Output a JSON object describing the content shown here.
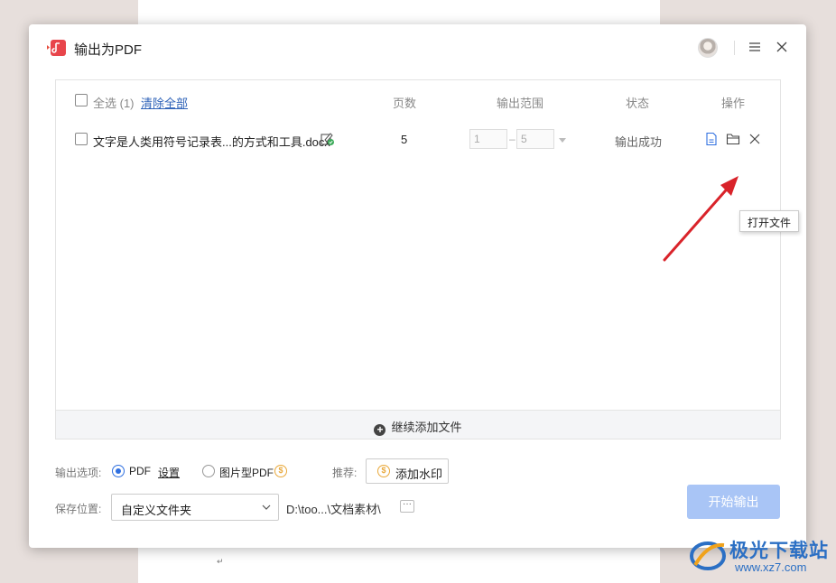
{
  "dialog": {
    "title": "输出为PDF"
  },
  "list": {
    "headers": {
      "select_all": "全选 (1)",
      "clear_all": "清除全部",
      "pages": "页数",
      "range": "输出范围",
      "status": "状态",
      "actions": "操作"
    },
    "rows": [
      {
        "filename": "文字是人类用符号记录表...的方式和工具.docx",
        "pages": "5",
        "range_from": "1",
        "range_to": "5",
        "range_dash": "–",
        "status": "输出成功"
      }
    ],
    "tooltip": "打开文件",
    "add_more": "继续添加文件"
  },
  "options": {
    "label": "输出选项:",
    "pdf": "PDF",
    "settings": "设置",
    "image_pdf": "图片型PDF",
    "recommend_label": "推荐:",
    "add_watermark": "添加水印",
    "save_label": "保存位置:",
    "save_select": "自定义文件夹",
    "save_path": "D:\\too...\\文档素材\\",
    "more": "···",
    "start": "开始输出"
  },
  "background": {
    "doc_mark": "↵"
  },
  "watermark": {
    "brand": "极光下载站",
    "url": "www.xz7.com"
  },
  "colors": {
    "accent": "#2f6fe0",
    "start_button": "#a9c5f6",
    "status_ok": "#3dab5a",
    "arrow": "#d9232a"
  },
  "icons": [
    "app-pdf-icon",
    "avatar",
    "menu-icon",
    "close-icon",
    "edit-check-icon",
    "open-file-icon",
    "open-folder-icon",
    "remove-icon",
    "plus-circle-icon",
    "coin-icon",
    "chevron-down-icon"
  ]
}
